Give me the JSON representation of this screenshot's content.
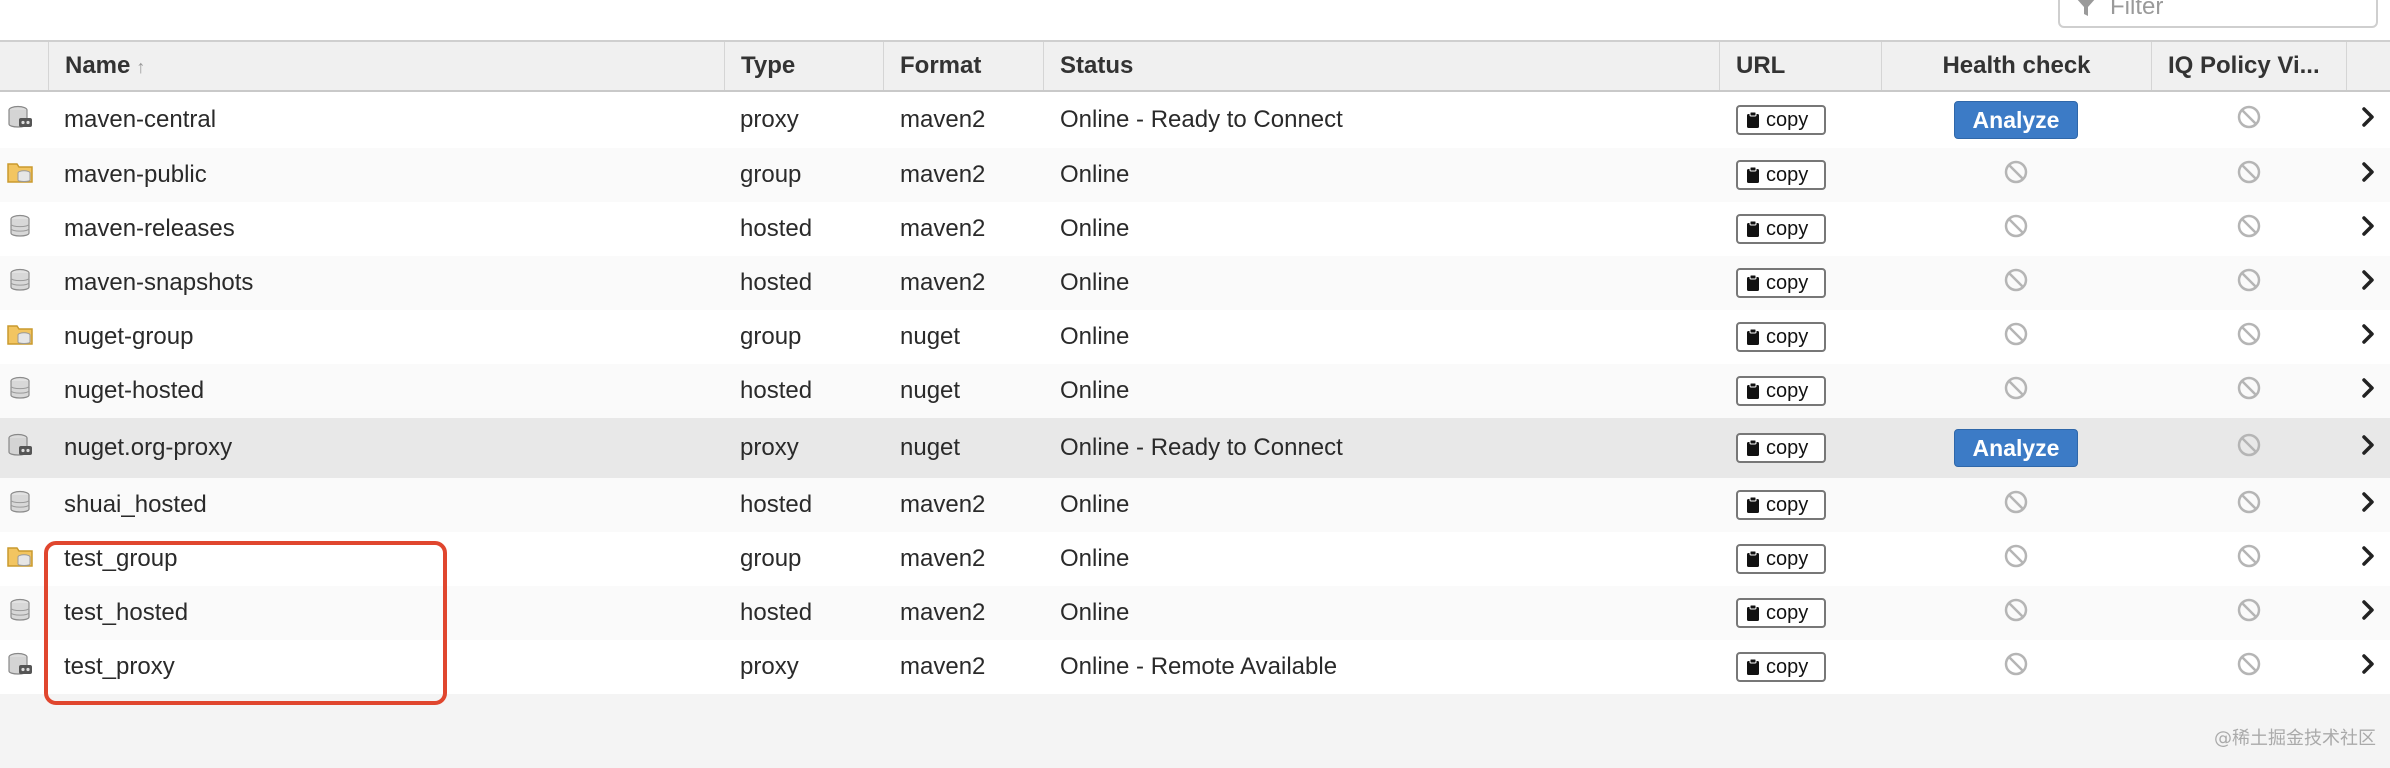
{
  "filter": {
    "placeholder": "Filter"
  },
  "columns": {
    "name": "Name",
    "type": "Type",
    "format": "Format",
    "status": "Status",
    "url": "URL",
    "health": "Health check",
    "iq": "IQ Policy Vi..."
  },
  "copy_label": "copy",
  "analyze_label": "Analyze",
  "rows": [
    {
      "name": "maven-central",
      "type": "proxy",
      "format": "maven2",
      "status": "Online - Ready to Connect",
      "icon": "proxy-repo-icon",
      "health": "analyze",
      "selected": false
    },
    {
      "name": "maven-public",
      "type": "group",
      "format": "maven2",
      "status": "Online",
      "icon": "group-repo-icon",
      "health": "na",
      "selected": false
    },
    {
      "name": "maven-releases",
      "type": "hosted",
      "format": "maven2",
      "status": "Online",
      "icon": "hosted-repo-icon",
      "health": "na",
      "selected": false
    },
    {
      "name": "maven-snapshots",
      "type": "hosted",
      "format": "maven2",
      "status": "Online",
      "icon": "hosted-repo-icon",
      "health": "na",
      "selected": false
    },
    {
      "name": "nuget-group",
      "type": "group",
      "format": "nuget",
      "status": "Online",
      "icon": "group-repo-icon",
      "health": "na",
      "selected": false
    },
    {
      "name": "nuget-hosted",
      "type": "hosted",
      "format": "nuget",
      "status": "Online",
      "icon": "hosted-repo-icon",
      "health": "na",
      "selected": false
    },
    {
      "name": "nuget.org-proxy",
      "type": "proxy",
      "format": "nuget",
      "status": "Online - Ready to Connect",
      "icon": "proxy-repo-icon",
      "health": "analyze",
      "selected": true
    },
    {
      "name": "shuai_hosted",
      "type": "hosted",
      "format": "maven2",
      "status": "Online",
      "icon": "hosted-repo-icon",
      "health": "na",
      "selected": false
    },
    {
      "name": "test_group",
      "type": "group",
      "format": "maven2",
      "status": "Online",
      "icon": "group-repo-icon",
      "health": "na",
      "selected": false
    },
    {
      "name": "test_hosted",
      "type": "hosted",
      "format": "maven2",
      "status": "Online",
      "icon": "hosted-repo-icon",
      "health": "na",
      "selected": false
    },
    {
      "name": "test_proxy",
      "type": "proxy",
      "format": "maven2",
      "status": "Online - Remote Available",
      "icon": "proxy-repo-icon",
      "health": "na",
      "selected": false
    }
  ],
  "watermark": "@稀土掘金技术社区",
  "colors": {
    "analyze": "#3c7bc6",
    "highlight": "#e0462e",
    "selected_row": "#e8e8e8"
  }
}
